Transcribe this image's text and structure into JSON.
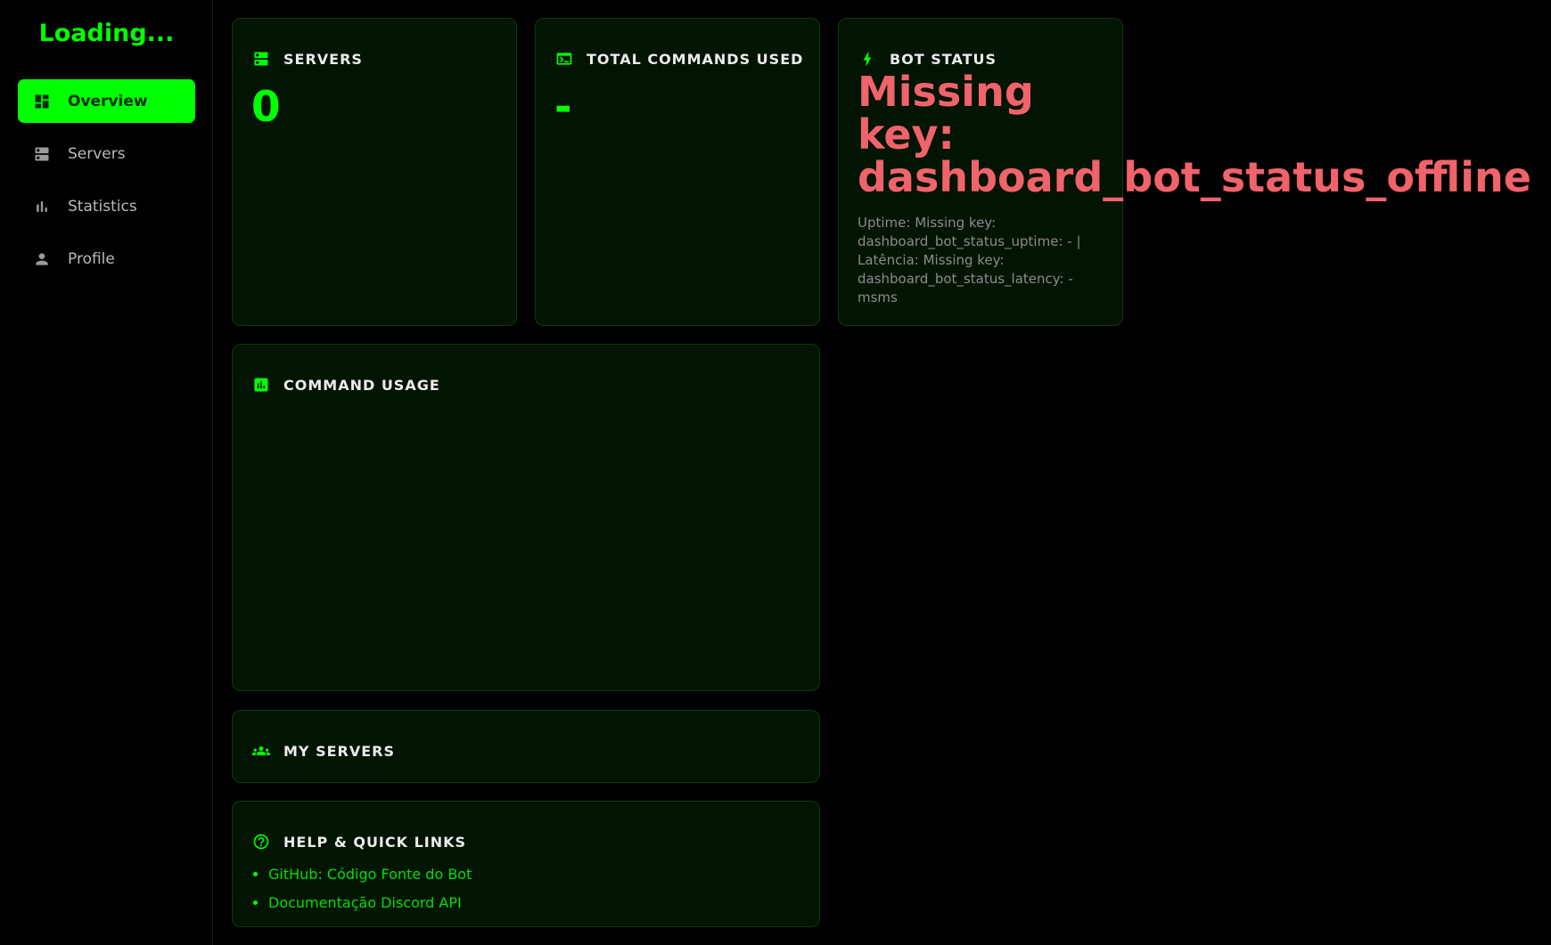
{
  "app": {
    "title": "Loading..."
  },
  "sidebar": {
    "items": [
      {
        "label": "Overview",
        "icon": "dashboard-icon",
        "active": true
      },
      {
        "label": "Servers",
        "icon": "dns-icon",
        "active": false
      },
      {
        "label": "Statistics",
        "icon": "bar-chart-icon",
        "active": false
      },
      {
        "label": "Profile",
        "icon": "person-icon",
        "active": false
      }
    ]
  },
  "cards": {
    "servers": {
      "title": "SERVERS",
      "value": "0",
      "icon": "dns-icon"
    },
    "commands": {
      "title": "TOTAL COMMANDS USED",
      "value": "-",
      "icon": "terminal-icon"
    },
    "bot_status": {
      "title": "BOT STATUS",
      "icon": "bolt-icon",
      "status_lines": [
        "Missing",
        "key:",
        "dashboard_bot_status_offline"
      ],
      "details": "Uptime: Missing key: dashboard_bot_status_uptime: - | Latência: Missing key: dashboard_bot_status_latency: -msms"
    },
    "command_usage": {
      "title": "COMMAND USAGE",
      "icon": "chart-icon"
    },
    "my_servers": {
      "title": "MY SERVERS",
      "icon": "groups-icon"
    },
    "help": {
      "title": "HELP & QUICK LINKS",
      "icon": "help-circle-icon",
      "links": [
        "GitHub: Código Fonte do Bot",
        "Documentação Discord API"
      ]
    }
  },
  "colors": {
    "accent": "#00ff00",
    "card_bg": "#021402",
    "error": "#f0636a",
    "background": "#000000"
  }
}
